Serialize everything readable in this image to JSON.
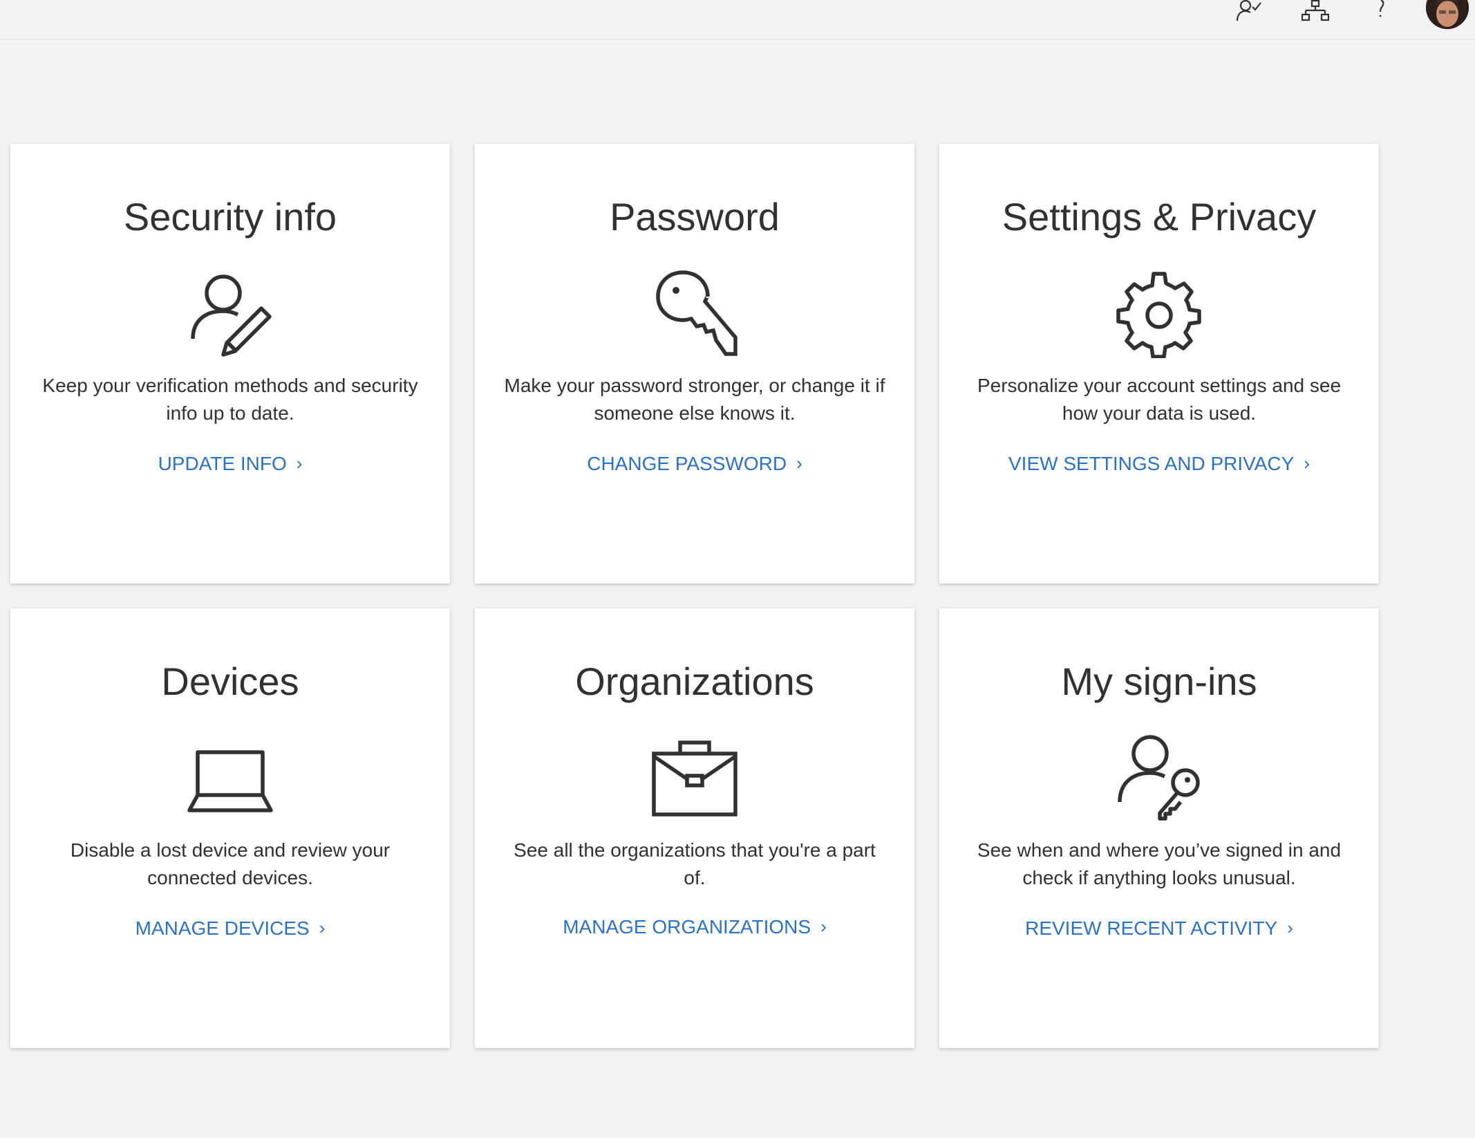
{
  "header": {
    "icons": [
      {
        "name": "manage-accounts-icon"
      },
      {
        "name": "org-chart-icon"
      },
      {
        "name": "help-icon"
      }
    ],
    "avatar": "user-avatar"
  },
  "cards": [
    {
      "title": "Security info",
      "icon": "user-edit-icon",
      "description": "Keep your verification methods and security info up to date.",
      "link": "UPDATE INFO"
    },
    {
      "title": "Password",
      "icon": "key-icon",
      "description": "Make your password stronger, or change it if someone else knows it.",
      "link": "CHANGE PASSWORD"
    },
    {
      "title": "Settings & Privacy",
      "icon": "gear-icon",
      "description": "Personalize your account settings and see how your data is used.",
      "link": "VIEW SETTINGS AND PRIVACY"
    },
    {
      "title": "Devices",
      "icon": "laptop-icon",
      "description": "Disable a lost device and review your connected devices.",
      "link": "MANAGE DEVICES"
    },
    {
      "title": "Organizations",
      "icon": "briefcase-icon",
      "description": "See all the organizations that you're a part of.",
      "link": "MANAGE ORGANIZATIONS"
    },
    {
      "title": "My sign-ins",
      "icon": "user-key-icon",
      "description": "See when and where you’ve signed in and check if anything looks unusual.",
      "link": "REVIEW RECENT ACTIVITY"
    }
  ],
  "colors": {
    "background": "#f2f2f2",
    "card": "#ffffff",
    "link": "#2b72c4",
    "text": "#323130"
  }
}
